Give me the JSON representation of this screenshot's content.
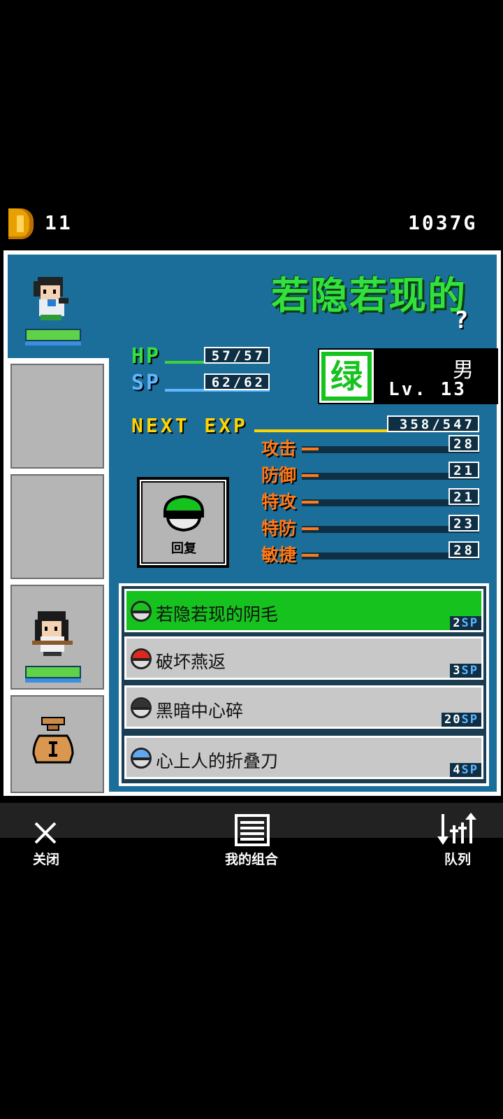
{
  "top": {
    "coins": "11",
    "gold": "1037G"
  },
  "character": {
    "name": "若隐若现的",
    "subtitle": "?",
    "hp": {
      "label": "HP",
      "value": "57/57",
      "fraction": 1.0
    },
    "sp": {
      "label": "SP",
      "value": "62/62",
      "fraction": 1.0
    },
    "type_glyph": "绿",
    "gender": "男",
    "level": "Lv. 13",
    "exp": {
      "label": "NEXT EXP",
      "value": "358/547",
      "fraction": 0.654
    },
    "stats": [
      {
        "label": "攻击",
        "value": "28"
      },
      {
        "label": "防御",
        "value": "21"
      },
      {
        "label": "特攻",
        "value": "21"
      },
      {
        "label": "特防",
        "value": "23"
      },
      {
        "label": "敏捷",
        "value": "28"
      }
    ],
    "item": {
      "label": "回复"
    }
  },
  "skills": [
    {
      "name": "若隐若现的阴毛",
      "sp": "2",
      "unit": "SP",
      "ball": "green",
      "active": true
    },
    {
      "name": "破坏燕返",
      "sp": "3",
      "unit": "SP",
      "ball": "red",
      "active": false
    },
    {
      "name": "黑暗中心碎",
      "sp": "20",
      "unit": "SP",
      "ball": "dark",
      "active": false
    },
    {
      "name": "心上人的折叠刀",
      "sp": "4",
      "unit": "SP",
      "ball": "blue",
      "active": false
    }
  ],
  "nav": {
    "close": "关闭",
    "combo": "我的组合",
    "queue": "队列"
  },
  "colors": {
    "panel_bg": "#1b6e99",
    "accent_green": "#32e13d",
    "stat_orange": "#ff7a1a",
    "exp_yellow": "#ffd400"
  }
}
